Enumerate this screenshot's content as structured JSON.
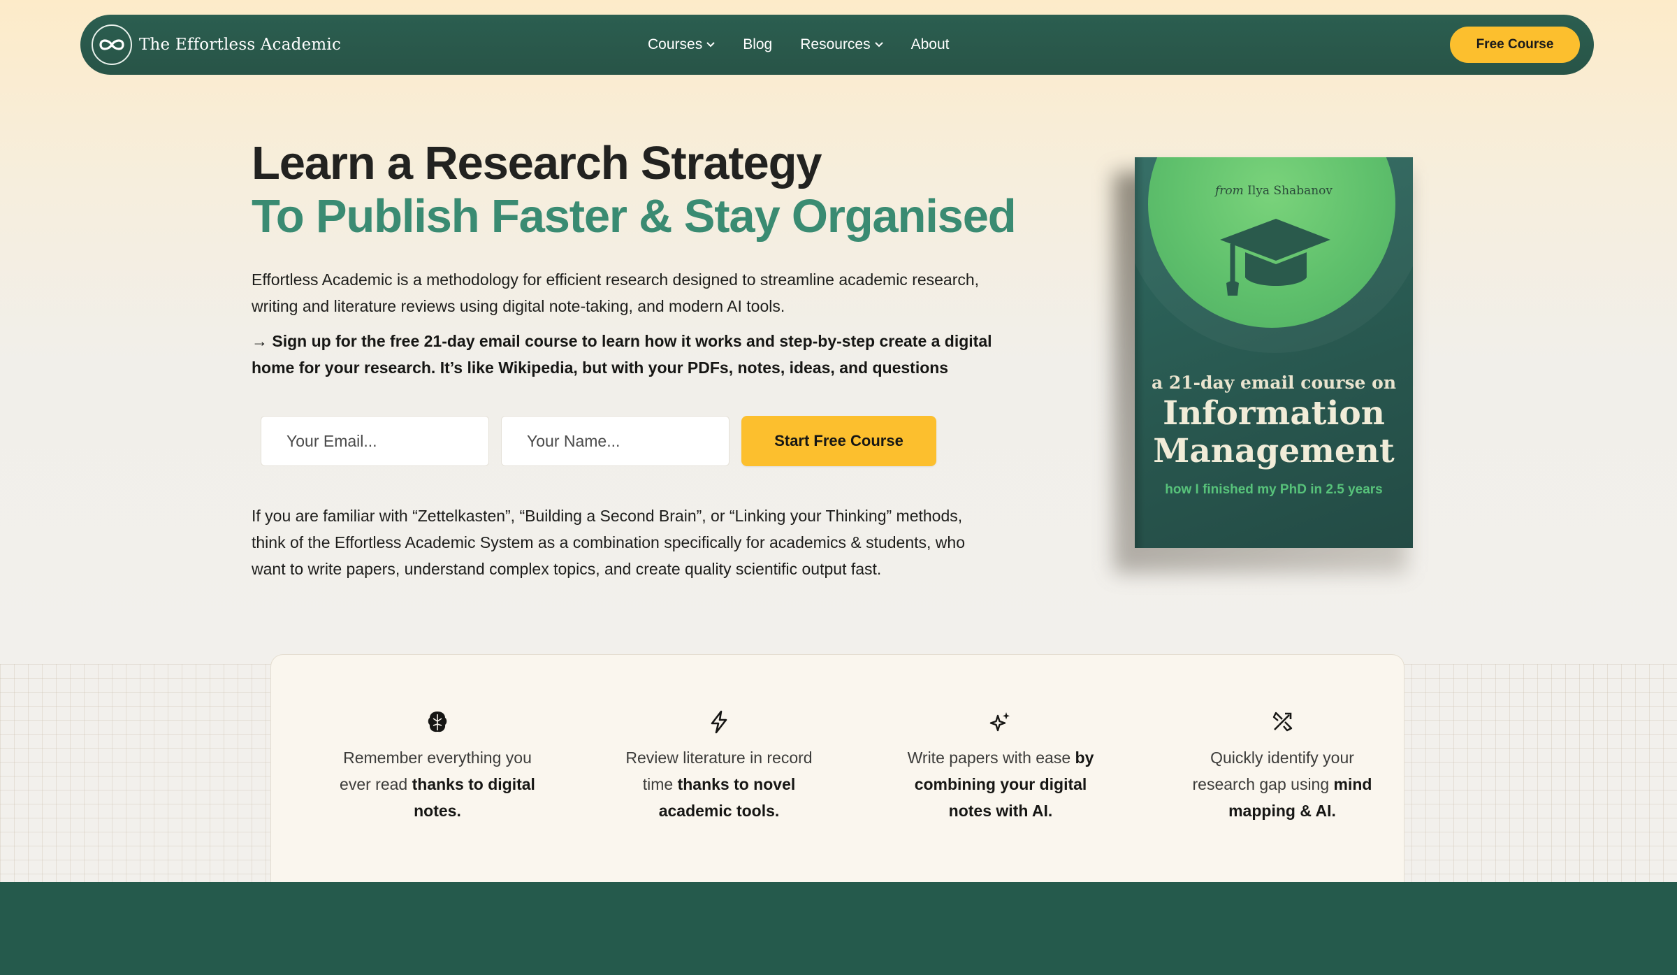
{
  "nav": {
    "brand": "The Effortless Academic",
    "links": [
      {
        "label": "Courses",
        "dropdown": true
      },
      {
        "label": "Blog",
        "dropdown": false
      },
      {
        "label": "Resources",
        "dropdown": true
      },
      {
        "label": "About",
        "dropdown": false
      }
    ],
    "cta_label": "Free Course"
  },
  "hero": {
    "title_line1": "Learn a Research Strategy",
    "title_line2": "To Publish Faster & Stay Organised",
    "intro": "Effortless Academic is a methodology for efficient research designed to streamline academic research, writing and literature reviews using digital note-taking, and modern AI tools.",
    "signup_text": "→ Sign up for the free 21-day email course to learn how it works and step-by-step create a digital home for your research. It’s like Wikipedia, but with your PDFs, notes, ideas, and questions",
    "email_placeholder": "Your Email...",
    "name_placeholder": "Your Name...",
    "submit_label": "Start Free Course",
    "familiar_text": "If you are familiar with “Zettelkasten”, “Building a Second Brain”, or “Linking your Thinking” methods, think of the Effortless Academic System as a combination specifically for academics & students, who want to write papers, understand complex topics, and create quality scientific output fast."
  },
  "book": {
    "author_prefix": "from",
    "author": "Ilya Shabanov",
    "subtitle": "a 21-day email course on",
    "title_line1": "Information",
    "title_line2": "Management",
    "tagline": "how I finished my PhD in 2.5 years"
  },
  "features": [
    {
      "icon": "brain-icon",
      "text": "Remember everything you ever read ",
      "bold": "thanks to digital notes."
    },
    {
      "icon": "lightning-icon",
      "text": "Review literature in record time ",
      "bold": "thanks to novel academic tools."
    },
    {
      "icon": "sparkles-icon",
      "text": "Write papers with ease ",
      "bold": "by combining your digital notes with AI."
    },
    {
      "icon": "target-arrow-icon",
      "text": "Quickly identify your research gap using ",
      "bold": "mind mapping & AI."
    }
  ],
  "colors": {
    "nav_bg": "#285447",
    "accent_yellow": "#fcbf2e",
    "title_green": "#3a8b72",
    "footer_green": "#255a4c"
  }
}
